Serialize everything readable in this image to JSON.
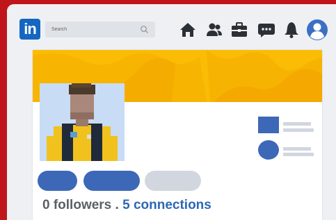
{
  "header": {
    "logo_text": "in",
    "search": {
      "placeholder": "Search",
      "icon": "search-icon"
    },
    "nav_icons": [
      "home-icon",
      "network-icon",
      "jobs-icon",
      "messaging-icon",
      "notifications-icon",
      "profile-icon"
    ]
  },
  "profile": {
    "followers_count": "0 followers",
    "separator": " . ",
    "connections_count": "5 connections"
  },
  "colors": {
    "brand_blue": "#1466c0",
    "banner_yellow": "#fbbc05",
    "action_blue": "#3d68b8",
    "muted_pill": "#d2d6df",
    "frame_red": "#c0151a"
  }
}
